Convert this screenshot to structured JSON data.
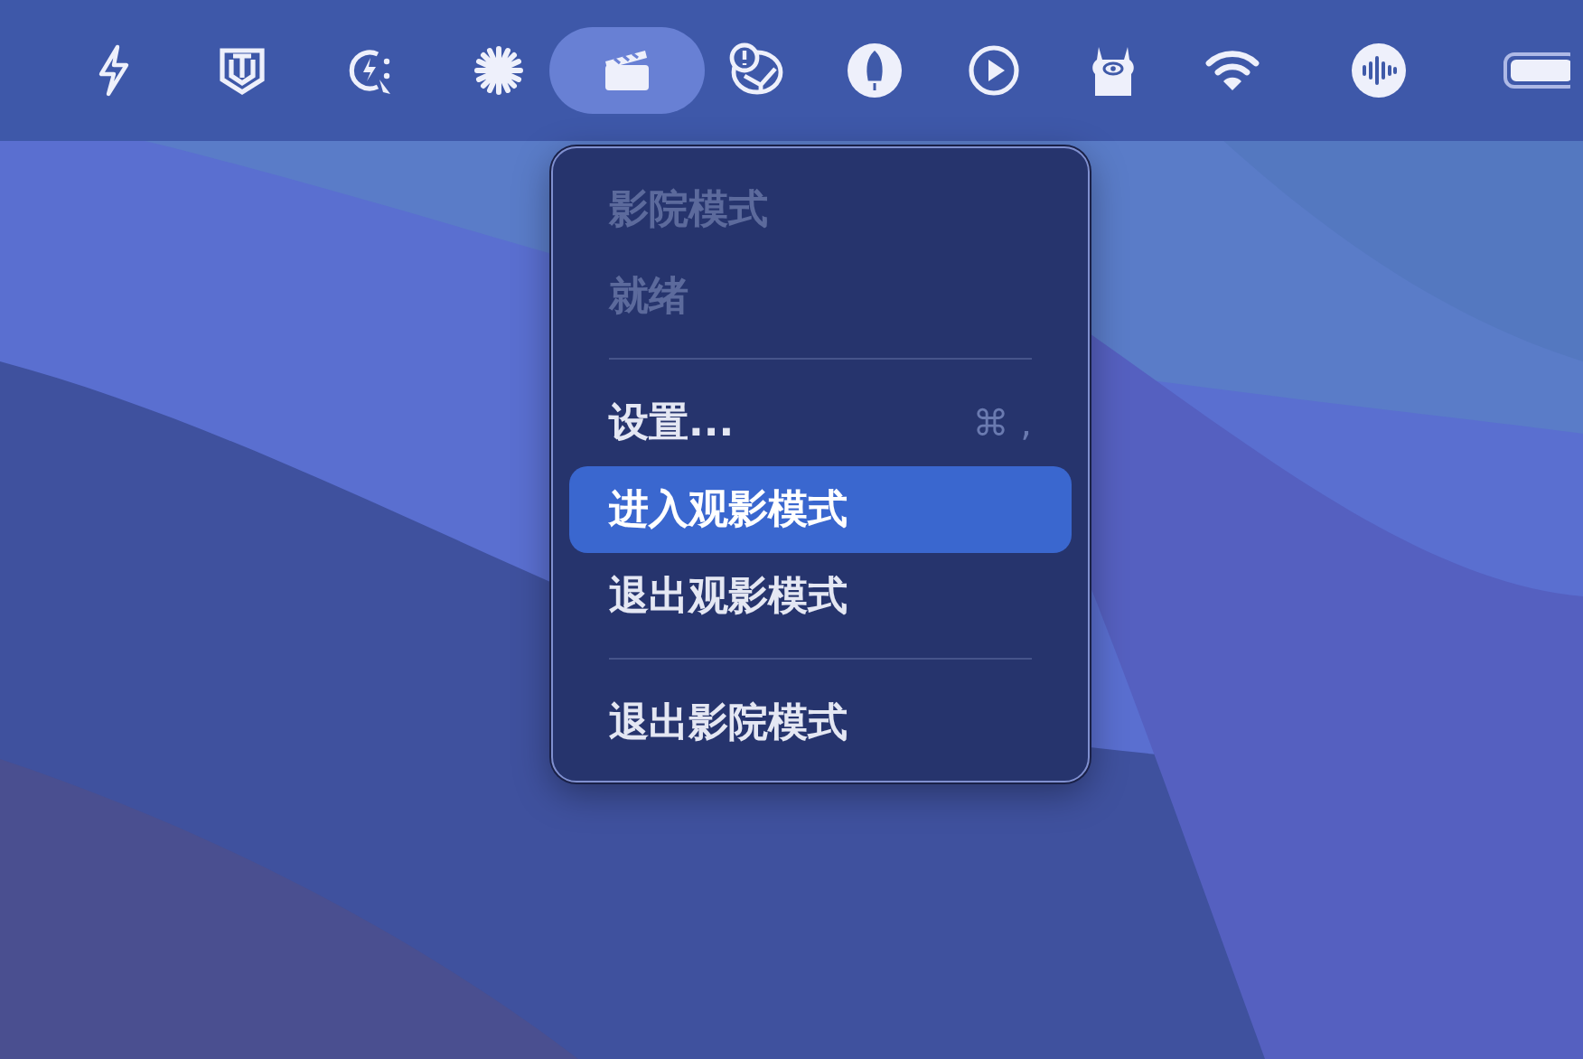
{
  "menu_bar": {
    "items": [
      {
        "selected": false
      },
      {
        "selected": false
      },
      {
        "selected": false
      },
      {
        "selected": false
      },
      {
        "selected": true
      },
      {
        "selected": false
      },
      {
        "selected": false
      },
      {
        "selected": false
      },
      {
        "selected": false
      },
      {
        "selected": false
      },
      {
        "selected": false
      },
      {
        "selected": false
      }
    ]
  },
  "menu": {
    "items": [
      {
        "kind": "label",
        "text": "影院模式",
        "disabled": true
      },
      {
        "kind": "label",
        "text": "就绪",
        "disabled": true
      },
      {
        "kind": "separator"
      },
      {
        "kind": "item",
        "text": "设置...",
        "shortcut": "⌘ ,",
        "selected": false
      },
      {
        "kind": "item",
        "text": "进入观影模式",
        "selected": true
      },
      {
        "kind": "item",
        "text": "退出观影模式",
        "selected": false
      },
      {
        "kind": "separator"
      },
      {
        "kind": "item",
        "text": "退出影院模式",
        "selected": false
      }
    ]
  }
}
